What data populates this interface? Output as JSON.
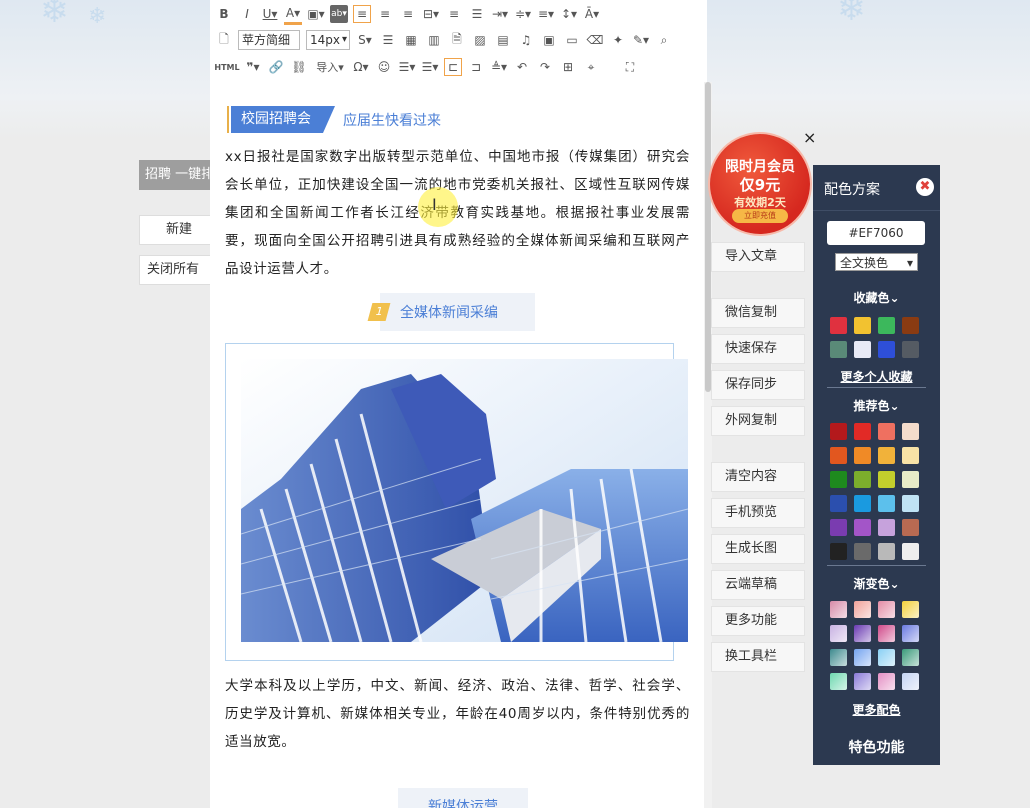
{
  "left_page": {
    "title": "招聘 一键排",
    "new_button": "新建",
    "close_all_button": "关闭所有"
  },
  "toolbar": {
    "row1": [
      "B",
      "I",
      "U",
      "A",
      "▯",
      "ab",
      "≡",
      "≡",
      "≡",
      "⌶",
      "≡",
      "≡",
      "≡",
      "≡",
      "≡",
      "↕",
      "Ā"
    ],
    "font_family": "苹方简细",
    "font_size": "14px",
    "html_label": "HTML",
    "import_label": "导入"
  },
  "article": {
    "section1_tag": "校园招聘会",
    "section1_sub": "应届生快看过来",
    "para1": "xx日报社是国家数字出版转型示范单位、中国地市报（传媒集团）研究会会长单位，正加快建设全国一流的地市党委机关报社、区域性互联网传媒集团和全国新闻工作者长江经济带教育实践基地。根据报社事业发展需要，现面向全国公开招聘引进具有成熟经验的全媒体新闻采编和互联网产品设计运营人才。",
    "mini_head1_badge": "1",
    "mini_head1": "全媒体新闻采编",
    "para2": "大学本科及以上学历，中文、新闻、经济、政治、法律、哲学、社会学、历史学及计算机、新媒体相关专业，年龄在40周岁以内，条件特别优秀的适当放宽。",
    "mini_head2": "新媒体运营"
  },
  "side_buttons": [
    "导入文章",
    "微信复制",
    "快速保存",
    "保存同步",
    "外网复制",
    "清空内容",
    "手机预览",
    "生成长图",
    "云端草稿",
    "更多功能",
    "换工具栏"
  ],
  "promo": {
    "line1": "限时月会员",
    "line2": "仅9元",
    "line3": "有效期2天",
    "button": "立即充值",
    "close": "×"
  },
  "color_panel": {
    "title": "配色方案",
    "close": "✖",
    "hex_value": "#EF7060",
    "mode": "全文换色",
    "favorites_label": "收藏色",
    "favorites_link": "更多个人收藏",
    "recommended_label": "推荐色",
    "gradient_label": "渐变色",
    "more_colors_link": "更多配色",
    "features_label": "特色功能",
    "favorites": [
      "#e0313f",
      "#f2c230",
      "#3cb85c",
      "#8a3b12",
      "#5a8a78",
      "#e8eaf6",
      "#2e4fd8",
      "#555b63"
    ],
    "recommended": [
      "#b3191c",
      "#e22a26",
      "#ef7060",
      "#f4dccc",
      "#e2571f",
      "#f08a26",
      "#f1b23a",
      "#f7e2a6",
      "#1e8a1e",
      "#7cae2c",
      "#c3cf2c",
      "#e8ecc8",
      "#2b4fae",
      "#1a9ae0",
      "#5cc0ec",
      "#bfe2f4",
      "#7a3cb0",
      "#a355c8",
      "#c6a2dc",
      "#b86a52",
      "#222222",
      "#6a6a6a",
      "#b9b9b9",
      "#eeeeee"
    ],
    "gradients": [
      "#d78aa8",
      "#f0a29a",
      "#e48ca6",
      "#f4d23c",
      "#c8b2e2",
      "#6a3ab2",
      "#d04a8a",
      "#6a7ae0",
      "#3e8a8e",
      "#74a4f0",
      "#8ad0f4",
      "#3a9a7a",
      "#6ed8b0",
      "#8a7ad8",
      "#e490c4",
      "#c4d4f4"
    ]
  }
}
